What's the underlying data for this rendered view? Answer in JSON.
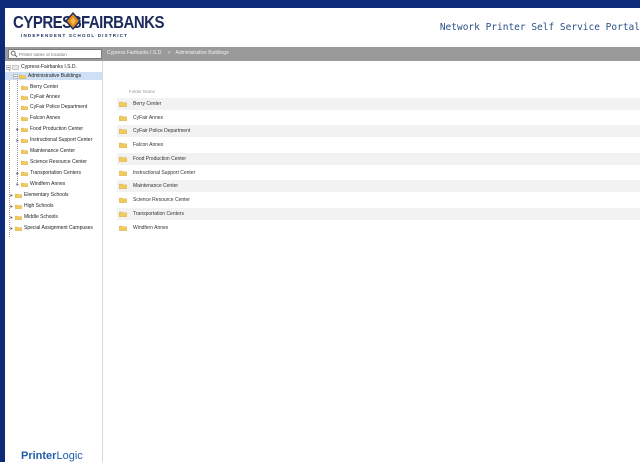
{
  "header": {
    "logo_left": "CYPRESS",
    "logo_right": "FAIRBANKS",
    "logo_sub": "INDEPENDENT SCHOOL DISTRICT",
    "portal_title": "Network Printer Self Service Portal"
  },
  "colors": {
    "background": "#0d2a7a",
    "toolbar": "#9a9a9a",
    "selected": "#cfe0f5",
    "folder": "#f1c95c",
    "row_alt": "#f2f2f2",
    "brand": "#1d2a5c",
    "logo_accent": "#e08a1e"
  },
  "search": {
    "placeholder": "Printer name or location",
    "icon": "search-icon"
  },
  "breadcrumb": {
    "items": [
      "Cypress Fairbanks I.S.D.",
      ">",
      "Administrative Buildings"
    ]
  },
  "sidebar": {
    "root": "Cypress-Fairbanks I.S.D.",
    "selected": "Administrative Buildings",
    "children": [
      "Berry Center",
      "CyFair Annex",
      "CyFair Police Department",
      "Falcon Annex",
      "Food Production Center",
      "Instructional Support Center",
      "Maintenance Center",
      "Science Resource Center",
      "Transportation Centers",
      "Windfern Annex"
    ],
    "siblings": [
      "Elementary Schools",
      "High Schools",
      "Middle Schools",
      "Special Assignment Campuses"
    ],
    "footer_brand": "Printer",
    "footer_brand_2": "Logic"
  },
  "main": {
    "column_header": "Folder Name",
    "rows": [
      "Berry Center",
      "CyFair Annex",
      "CyFair Police Department",
      "Falcon Annex",
      "Food Production Center",
      "Instructional Support Center",
      "Maintenance Center",
      "Science Resource Center",
      "Transportation Centers",
      "Windfern Annex"
    ]
  }
}
